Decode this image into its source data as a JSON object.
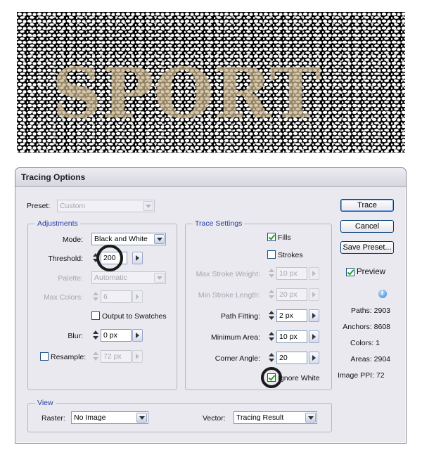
{
  "preview": {
    "text": "SPORT"
  },
  "dialog": {
    "title": "Tracing Options",
    "preset": {
      "label": "Preset:",
      "value": "Custom"
    },
    "adjustments": {
      "title": "Adjustments",
      "mode": {
        "label": "Mode:",
        "value": "Black and White"
      },
      "threshold": {
        "label": "Threshold:",
        "value": "200"
      },
      "palette": {
        "label": "Palette:",
        "value": "Automatic"
      },
      "max_colors": {
        "label": "Max Colors:",
        "value": "6"
      },
      "output_to_swatches": {
        "label": "Output to Swatches",
        "checked": false
      },
      "blur": {
        "label": "Blur:",
        "value": "0 px"
      },
      "resample": {
        "label": "Resample:",
        "value": "72 px",
        "checked": false
      }
    },
    "trace_settings": {
      "title": "Trace Settings",
      "fills": {
        "label": "Fills",
        "checked": true
      },
      "strokes": {
        "label": "Strokes",
        "checked": false
      },
      "max_stroke_weight": {
        "label": "Max Stroke Weight:",
        "value": "10 px"
      },
      "min_stroke_length": {
        "label": "Min Stroke Length:",
        "value": "20 px"
      },
      "path_fitting": {
        "label": "Path Fitting:",
        "value": "2 px"
      },
      "minimum_area": {
        "label": "Minimum Area:",
        "value": "10 px"
      },
      "corner_angle": {
        "label": "Corner Angle:",
        "value": "20"
      },
      "ignore_white": {
        "label": "Ignore White",
        "checked": true
      }
    },
    "view": {
      "title": "View",
      "raster": {
        "label": "Raster:",
        "value": "No Image"
      },
      "vector": {
        "label": "Vector:",
        "value": "Tracing Result"
      }
    },
    "buttons": {
      "trace": "Trace",
      "cancel": "Cancel",
      "save_preset": "Save Preset..."
    },
    "preview_checkbox": {
      "label": "Preview",
      "checked": true
    },
    "stats": {
      "paths": "Paths: 2903",
      "anchors": "Anchors: 8608",
      "colors": "Colors: 1",
      "areas": "Areas: 2904",
      "image_ppi": "Image PPI: 72"
    },
    "colors": {
      "group_title": "#2a3ea8",
      "check": "#21a121",
      "highlight_ring": "#1a1a1a"
    }
  }
}
